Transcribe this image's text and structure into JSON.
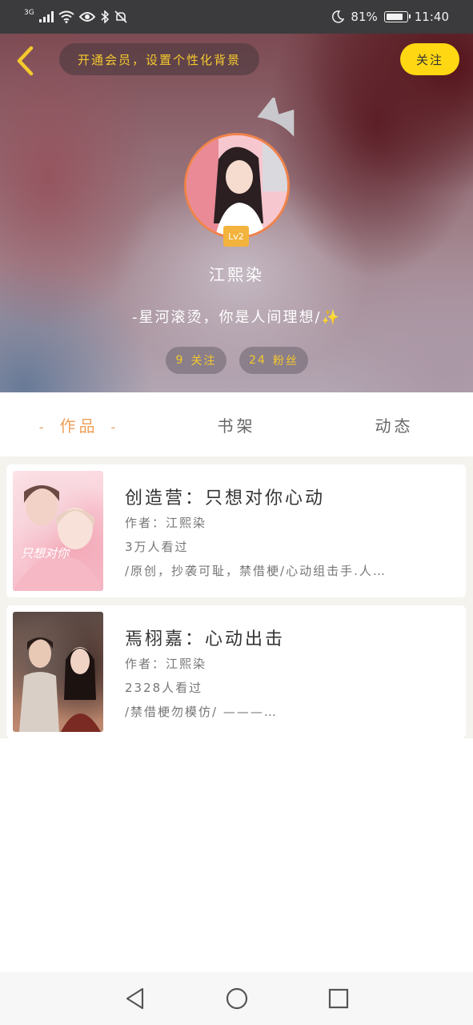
{
  "status_bar": {
    "network": "3G",
    "battery": "81%",
    "time": "11:40"
  },
  "header": {
    "vip_banner": "开通会员，设置个性化背景",
    "follow_label": "关注",
    "level": "Lv2",
    "username": "江熙染",
    "signature": "-星河滚烫，你是人间理想/",
    "signature_emoji": "✨",
    "following": {
      "count": "9",
      "label": "关注"
    },
    "fans": {
      "count": "24",
      "label": "粉丝"
    }
  },
  "tabs": [
    {
      "label": "作品",
      "active": true
    },
    {
      "label": "书架",
      "active": false
    },
    {
      "label": "动态",
      "active": false
    }
  ],
  "works": [
    {
      "title": "创造营：只想对你心动",
      "author": "作者：江熙染",
      "views": "3万人看过",
      "description": "/原创，抄袭可耻，禁借梗/心动组击手.人…"
    },
    {
      "title": "焉栩嘉：心动出击",
      "author": "作者：江熙染",
      "views": "2328人看过",
      "description": "/禁借梗勿模仿/ ———…"
    }
  ],
  "colors": {
    "accent_yellow": "#ffd712",
    "tab_active": "#f0a05a",
    "avatar_ring": "#f0834a",
    "level_badge": "#f3b33c"
  }
}
